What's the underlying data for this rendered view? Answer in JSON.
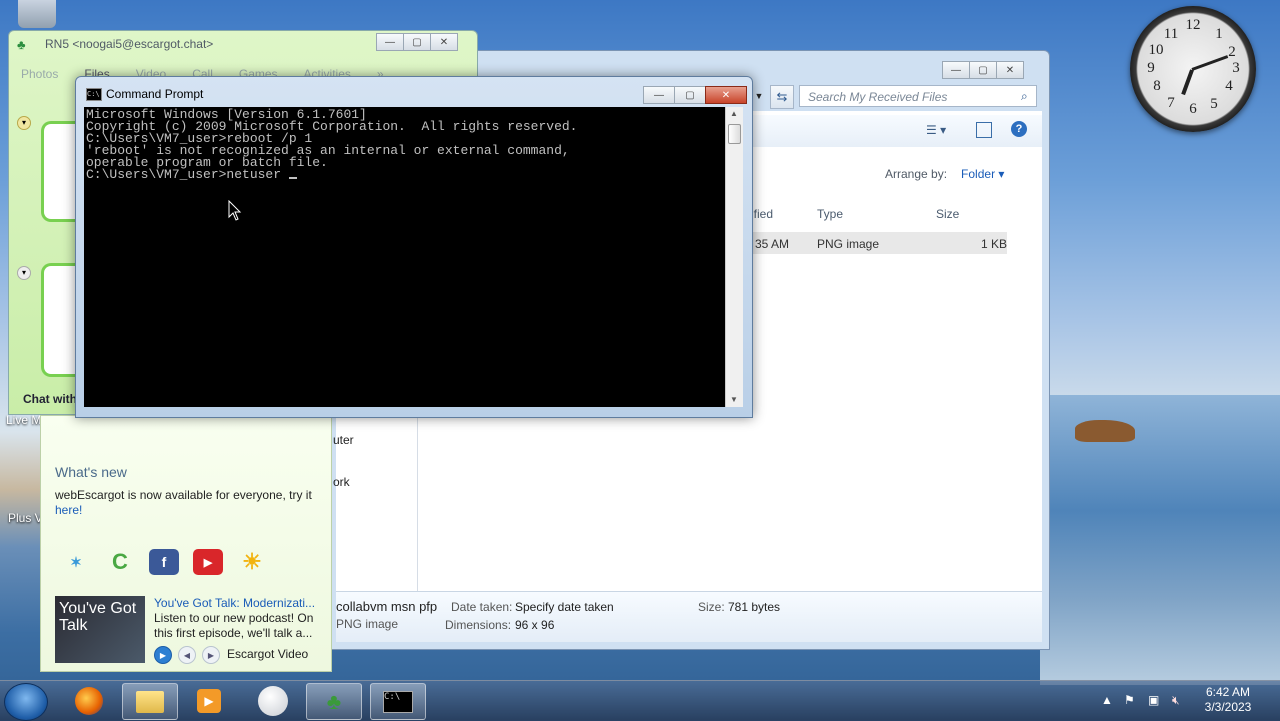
{
  "desktop": {
    "icons": [
      "Live M",
      "Plus V"
    ]
  },
  "clock": {
    "numbers": [
      "12",
      "1",
      "2",
      "3",
      "4",
      "5",
      "6",
      "7",
      "8",
      "9",
      "10",
      "11"
    ]
  },
  "messenger": {
    "title": "RN5 <noogai5@escargot.chat>",
    "tabs": [
      "Photos",
      "Files",
      "Video",
      "Call",
      "Games",
      "Activities"
    ],
    "more": "»",
    "chat_with": "Chat with",
    "whats_new_title": "What's new",
    "whats_new_text": "webEscargot is now available for everyone, try it",
    "whats_new_link": "here!",
    "podcast": {
      "title": "You've Got Talk: Modernizati...",
      "desc": "Listen to our new podcast! On this first episode, we'll talk a...",
      "thumb_text": "You've Got Talk",
      "source": "Escargot Video"
    }
  },
  "explorer": {
    "search_placeholder": "Search My Received Files",
    "arrange_by": "Arrange by:",
    "arrange_value": "Folder ▾",
    "columns": {
      "modified": "ified",
      "type": "Type",
      "size": "Size"
    },
    "row": {
      "modified": "35 AM",
      "type": "PNG image",
      "size": "1 KB"
    },
    "nav": [
      "uter",
      "ork"
    ],
    "details": {
      "name": "collabvm msn pfp",
      "type": "PNG image",
      "date_label": "Date taken:",
      "date_value": "Specify date taken",
      "dim_label": "Dimensions:",
      "dim_value": "96 x 96",
      "size_label": "Size:",
      "size_value": "781 bytes"
    }
  },
  "cmd": {
    "title": "Command Prompt",
    "lines": [
      "Microsoft Windows [Version 6.1.7601]",
      "Copyright (c) 2009 Microsoft Corporation.  All rights reserved.",
      "",
      "C:\\Users\\VM7_user>reboot /p 1",
      "'reboot' is not recognized as an internal or external command,",
      "operable program or batch file.",
      "",
      "C:\\Users\\VM7_user>netuser "
    ]
  },
  "taskbar": {
    "time": "6:42 AM",
    "date": "3/3/2023"
  }
}
